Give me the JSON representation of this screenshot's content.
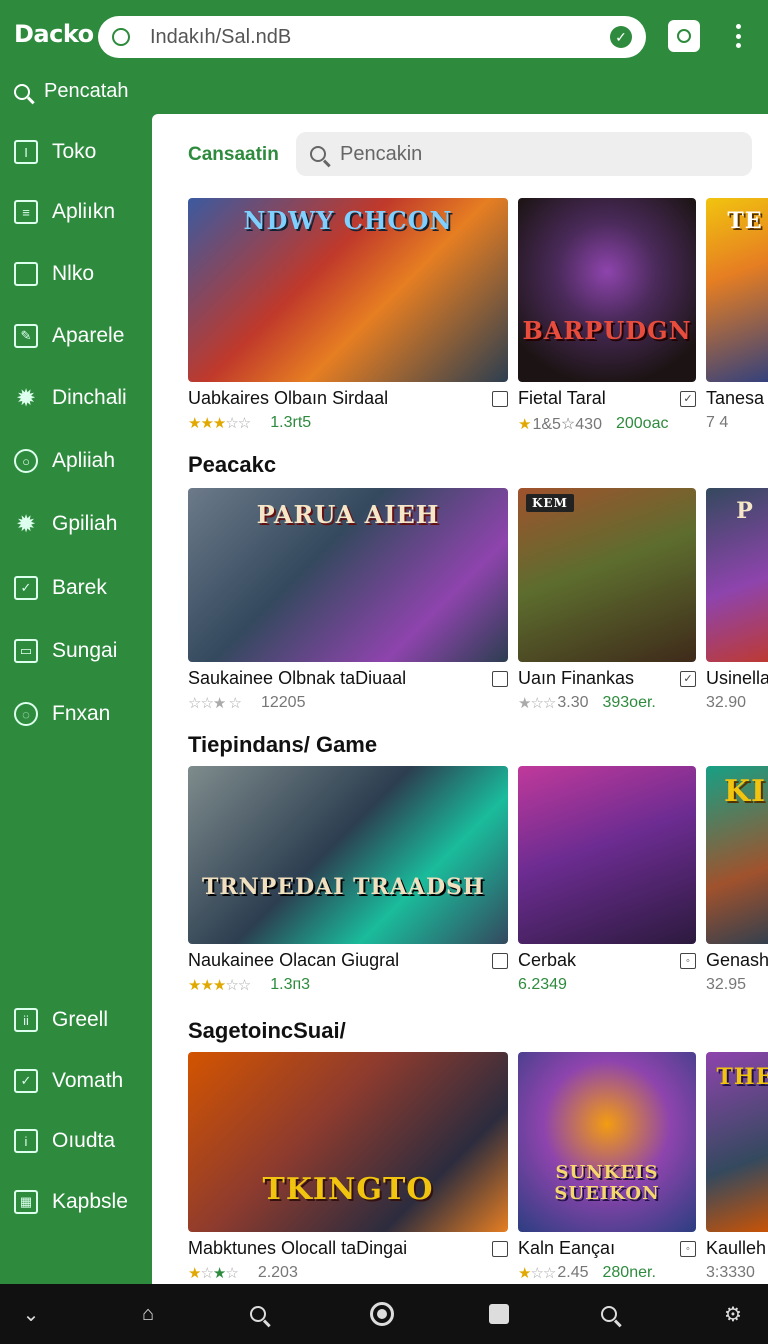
{
  "header": {
    "brand": "Dacko",
    "url": "Indakıh/Sal.ndB"
  },
  "sidebar": {
    "search_label": "Pencatah",
    "items": [
      {
        "label": "Toko"
      },
      {
        "label": "Apliıkn"
      },
      {
        "label": "Nlko"
      },
      {
        "label": "Aparele"
      },
      {
        "label": "Dinchali"
      },
      {
        "label": "Apliiah"
      },
      {
        "label": "Gpiliah"
      },
      {
        "label": "Barek"
      },
      {
        "label": "Sungai"
      },
      {
        "label": "Fnxan"
      },
      {
        "label": "Greell"
      },
      {
        "label": "Vomath"
      },
      {
        "label": "Oıudta"
      },
      {
        "label": "Kapbsle"
      }
    ]
  },
  "main": {
    "heading": "Cansaatin",
    "search_placeholder": "Pencakin",
    "sections": [
      {
        "title": "",
        "cards": [
          {
            "title": "Uabkaires Olbaın Sirdaal",
            "meta": "1.3rt5",
            "art": "NDWY CHCON"
          },
          {
            "title": "Fietal Taral",
            "meta": "1&5☆430",
            "meta2": "200oac",
            "art": "BARPUDGN"
          },
          {
            "title": "Tanesa",
            "meta": "7 4",
            "art": "TE"
          }
        ]
      },
      {
        "title": "Peacakc",
        "cards": [
          {
            "title": "Saukainee Olbnak taDiuaal",
            "meta": "12205",
            "art": "PARUA AIEH"
          },
          {
            "title": "Uaın Finankas",
            "meta": "3.30",
            "meta2": "393oer.",
            "art": "KEM"
          },
          {
            "title": "Usinella",
            "meta": "32.90",
            "art": "P"
          }
        ]
      },
      {
        "title": "Tiepindans/ Game",
        "cards": [
          {
            "title": "Naukainee Olacan Giugral",
            "meta": "1.3п3",
            "art": "TRNPEDAI TRAADSH"
          },
          {
            "title": "Cerbak",
            "meta": "6.2349",
            "art": ""
          },
          {
            "title": "Genash",
            "meta": "32.95",
            "art": "KI"
          }
        ]
      },
      {
        "title": "SagetoincSuai/",
        "cards": [
          {
            "title": "Mabktunes Olocall taDingai",
            "meta": "2.203",
            "art": "TKINGTO"
          },
          {
            "title": "Kaln Eançaı",
            "meta": "2.45",
            "meta2": "280ner.",
            "art": "SUNKEIS SUEIKON"
          },
          {
            "title": "Kaulleh",
            "meta": "3:3330",
            "art": "THE"
          }
        ]
      }
    ]
  },
  "colors": {
    "accent": "#2e8b3e",
    "background": "#ffffff",
    "nav": "#111111"
  }
}
